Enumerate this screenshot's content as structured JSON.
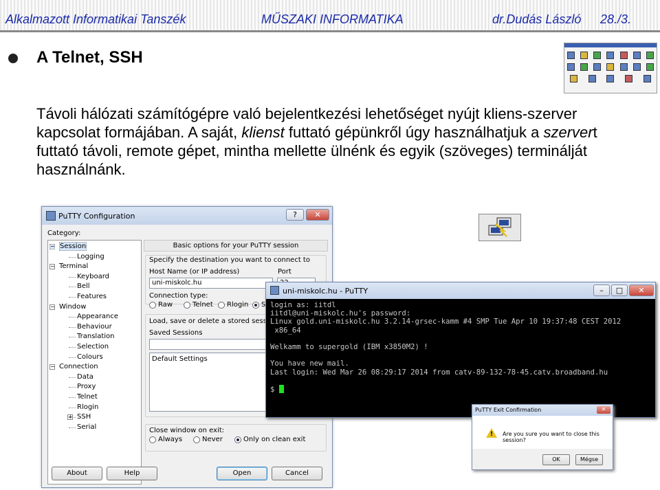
{
  "header": {
    "department": "Alkalmazott Informatikai Tanszék",
    "subject": "MŰSZAKI INFORMATIKA",
    "author": "dr.Dudás László",
    "page": "28./3."
  },
  "slide": {
    "title": "A Telnet, SSH",
    "p1": "Távoli hálózati számítógépre való bejelentkezési lehetőséget nyújt kliens-szerver kapcsolat formájában. A saját, ",
    "em1": "klienst",
    "p2": " futtató gépünkről úgy használhatjuk a ",
    "em2": "szerver",
    "p3": "t futtató távoli, remote gépet, mintha mellette ülnénk és egyik (szöveges) terminálját használnánk."
  },
  "putty_config": {
    "title": "PuTTY Configuration",
    "category_label": "Category:",
    "tree": [
      {
        "label": "Session",
        "depth": 0,
        "expander": "−",
        "selected": true
      },
      {
        "label": "Logging",
        "depth": 1
      },
      {
        "label": "Terminal",
        "depth": 0,
        "expander": "−"
      },
      {
        "label": "Keyboard",
        "depth": 1
      },
      {
        "label": "Bell",
        "depth": 1
      },
      {
        "label": "Features",
        "depth": 1
      },
      {
        "label": "Window",
        "depth": 0,
        "expander": "−"
      },
      {
        "label": "Appearance",
        "depth": 1
      },
      {
        "label": "Behaviour",
        "depth": 1
      },
      {
        "label": "Translation",
        "depth": 1
      },
      {
        "label": "Selection",
        "depth": 1
      },
      {
        "label": "Colours",
        "depth": 1
      },
      {
        "label": "Connection",
        "depth": 0,
        "expander": "−"
      },
      {
        "label": "Data",
        "depth": 1
      },
      {
        "label": "Proxy",
        "depth": 1
      },
      {
        "label": "Telnet",
        "depth": 1
      },
      {
        "label": "Rlogin",
        "depth": 1
      },
      {
        "label": "SSH",
        "depth": 1,
        "expander": "+"
      },
      {
        "label": "Serial",
        "depth": 1
      }
    ],
    "panel_header": "Basic options for your PuTTY session",
    "destination_label": "Specify the destination you want to connect to",
    "host_label": "Host Name (or IP address)",
    "host_value": "uni-miskolc.hu",
    "port_label": "Port",
    "port_value": "22",
    "conn_type_label": "Connection type:",
    "conn_types": [
      "Raw",
      "Telnet",
      "Rlogin",
      "S"
    ],
    "load_label": "Load, save or delete a stored session",
    "saved_sessions_label": "Saved Sessions",
    "sessions": [
      "Default Settings"
    ],
    "close_label": "Close window on exit:",
    "close_options": [
      "Always",
      "Never",
      "Only on clean exit"
    ],
    "buttons": {
      "about": "About",
      "help": "Help",
      "open": "Open",
      "cancel": "Cancel"
    }
  },
  "terminal": {
    "title": "uni-miskolc.hu - PuTTY",
    "lines": [
      "login as: iitdl",
      "iitdl@uni-miskolc.hu's password:",
      "Linux gold.uni-miskolc.hu 3.2.14-grsec-kamm #4 SMP Tue Apr 10 19:37:48 CEST 2012",
      " x86_64",
      "",
      "Welkamm to supergold (IBM x3850M2) !",
      "",
      "You have new mail.",
      "Last login: Wed Mar 26 08:29:17 2014 from catv-89-132-78-45.catv.broadband.hu",
      "",
      "$ "
    ],
    "cursor_color": "#1ce21c"
  },
  "exit_dialog": {
    "title": "PuTTY Exit Confirmation",
    "message": "Are you sure you want to close this session?",
    "ok": "OK",
    "cancel": "Mégse"
  },
  "icons": [
    "putty-icon",
    "winscp-thumbnail",
    "warning-icon"
  ]
}
